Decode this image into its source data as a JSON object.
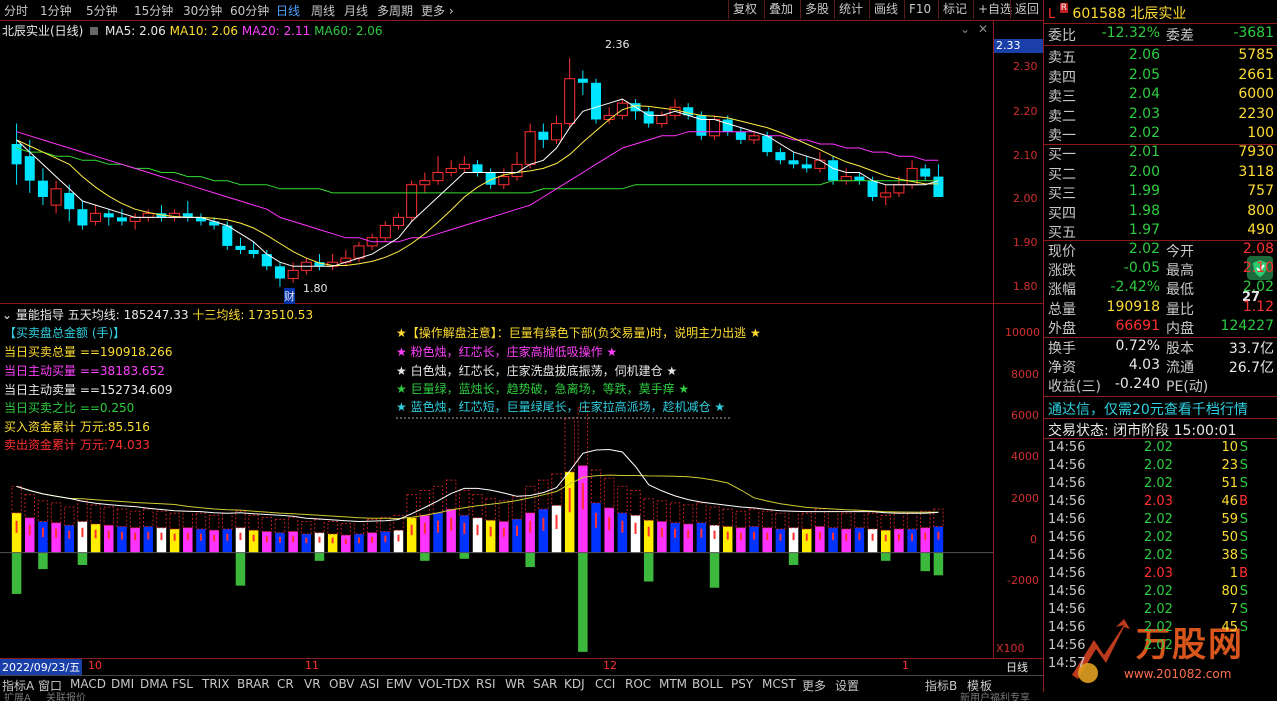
{
  "periods": [
    "分时",
    "1分钟",
    "5分钟",
    "15分钟",
    "30分钟",
    "60分钟",
    "日线",
    "周线",
    "月线",
    "多周期",
    "更多"
  ],
  "period_selected": "日线",
  "toolbar": [
    "复权",
    "叠加",
    "多股",
    "统计",
    "画线",
    "F10",
    "标记",
    "+自选",
    "返回"
  ],
  "title": "北辰实业(日线)",
  "ma": {
    "ma5": "MA5: 2.06",
    "ma10": "MA10: 2.06",
    "ma20": "MA20: 2.11",
    "ma60": "MA60: 2.06"
  },
  "price_axis": [
    "2.30",
    "2.20",
    "2.10",
    "2.00",
    "1.90",
    "1.80"
  ],
  "price_tag": "2.33",
  "high_label": "2.36",
  "low_label": "1.80",
  "cai_label": "财",
  "vol_header": {
    "name": "量能指导",
    "five": "五天均线: 185247.33",
    "thirteen": "十三均线: 173510.53"
  },
  "vol_axis": [
    "10000",
    "8000",
    "6000",
    "4000",
    "2000",
    "0",
    "-2000"
  ],
  "x100": "X100",
  "indicators": [
    {
      "text": "【买卖盘总金额 (手)】",
      "color": "#30d0e0"
    },
    {
      "text": "当日买卖总量 ==190918.266",
      "color": "#ffdd33"
    },
    {
      "text": "当日主动买量 ==38183.652",
      "color": "#ff40ff"
    },
    {
      "text": "当日主动卖量 ==152734.609",
      "color": "#e8e8e8"
    },
    {
      "text": "当日买卖之比 ==0.250",
      "color": "#2ecc40"
    },
    {
      "text": "买入资金累计 万元:85.516",
      "color": "#ffdd33"
    },
    {
      "text": "卖出资金累计 万元:74.033",
      "color": "#ff3030"
    }
  ],
  "notes": [
    {
      "text": "★【操作解盘注意】：巨量有绿色下部(负交易量)时，说明主力出逃 ★",
      "color": "#ffdd33"
    },
    {
      "text": "★ 粉色烛，红芯长，庄家高抛低吸操作 ★",
      "color": "#ff40ff"
    },
    {
      "text": "★ 白色烛，红芯长，庄家洗盘拔底振荡，伺机建仓 ★",
      "color": "#e8e8e8"
    },
    {
      "text": "★ 巨量绿，蓝烛长，趋势破，急离场，等跌，莫手痒 ★",
      "color": "#2ecc40"
    },
    {
      "text": "★ 蓝色烛，红芯短，巨量绿尾长，庄家拉高派场，趁机减仓 ★",
      "color": "#30d0e0"
    }
  ],
  "dates": {
    "start": "2022/09/23/五",
    "m10": "10",
    "m11": "11",
    "m12": "12",
    "m1": "1",
    "period": "日线"
  },
  "tabs": [
    "指标A",
    "窗口",
    "MACD",
    "DMI",
    "DMA",
    "FSL",
    "TRIX",
    "BRAR",
    "CR",
    "VR",
    "OBV",
    "ASI",
    "EMV",
    "VOL-TDX",
    "RSI",
    "WR",
    "SAR",
    "KDJ",
    "CCI",
    "ROC",
    "MTM",
    "BOLL",
    "PSY",
    "MCST",
    "更多",
    "设置"
  ],
  "tabs_right": [
    "指标B",
    "模",
    "板"
  ],
  "bottom": [
    "扩展A",
    "关联报价",
    "新用户福利专享"
  ],
  "stock": {
    "code": "601588",
    "name": "北辰实业",
    "tag_l": "L",
    "tag_r": "R"
  },
  "weibi": {
    "label": "委比",
    "value": "-12.32%",
    "label2": "委差",
    "value2": "-3681"
  },
  "sells": [
    {
      "label": "卖五",
      "price": "2.06",
      "vol": "5785"
    },
    {
      "label": "卖四",
      "price": "2.05",
      "vol": "2661"
    },
    {
      "label": "卖三",
      "price": "2.04",
      "vol": "6000"
    },
    {
      "label": "卖二",
      "price": "2.03",
      "vol": "2230"
    },
    {
      "label": "卖一",
      "price": "2.02",
      "vol": "100"
    }
  ],
  "buys": [
    {
      "label": "买一",
      "price": "2.01",
      "vol": "7930"
    },
    {
      "label": "买二",
      "price": "2.00",
      "vol": "3118"
    },
    {
      "label": "买三",
      "price": "1.99",
      "vol": "757"
    },
    {
      "label": "买四",
      "price": "1.98",
      "vol": "800"
    },
    {
      "label": "买五",
      "price": "1.97",
      "vol": "490"
    }
  ],
  "quote": [
    {
      "l1": "现价",
      "v1": "2.02",
      "c1": "g",
      "l2": "今开",
      "v2": "2.08",
      "c2": "r"
    },
    {
      "l1": "涨跌",
      "v1": "-0.05",
      "c1": "g",
      "l2": "最高",
      "v2": "2.10",
      "c2": "r"
    },
    {
      "l1": "涨幅",
      "v1": "-2.42%",
      "c1": "g",
      "l2": "最低",
      "v2": "2.02",
      "c2": "g"
    },
    {
      "l1": "总量",
      "v1": "190918",
      "c1": "y",
      "l2": "量比",
      "v2": "1.12",
      "c2": "r"
    },
    {
      "l1": "外盘",
      "v1": "66691",
      "c1": "r",
      "l2": "内盘",
      "v2": "124227",
      "c2": "g"
    }
  ],
  "quote2": [
    {
      "l1": "换手",
      "v1": "0.72%",
      "l2": "股本",
      "v2": "33.7亿"
    },
    {
      "l1": "净资",
      "v1": "4.03",
      "l2": "流通",
      "v2": "26.7亿"
    },
    {
      "l1": "收益(三)",
      "v1": "-0.240",
      "l2": "PE(动)",
      "v2": ""
    }
  ],
  "badge": "27",
  "ad": "通达信，仅需20元查看千档行情",
  "status": "交易状态: 闭市阶段 15:00:01",
  "ticks": [
    {
      "t": "14:56",
      "p": "2.02",
      "v": "10",
      "s": "S"
    },
    {
      "t": "14:56",
      "p": "2.02",
      "v": "23",
      "s": "S"
    },
    {
      "t": "14:56",
      "p": "2.02",
      "v": "51",
      "s": "S"
    },
    {
      "t": "14:56",
      "p": "2.03",
      "v": "46",
      "s": "B"
    },
    {
      "t": "14:56",
      "p": "2.02",
      "v": "59",
      "s": "S"
    },
    {
      "t": "14:56",
      "p": "2.02",
      "v": "50",
      "s": "S"
    },
    {
      "t": "14:56",
      "p": "2.02",
      "v": "38",
      "s": "S"
    },
    {
      "t": "14:56",
      "p": "2.03",
      "v": "1",
      "s": "B"
    },
    {
      "t": "14:56",
      "p": "2.02",
      "v": "80",
      "s": "S"
    },
    {
      "t": "14:56",
      "p": "2.02",
      "v": "7",
      "s": "S"
    },
    {
      "t": "14:56",
      "p": "2.02",
      "v": "45",
      "s": "S"
    },
    {
      "t": "14:56",
      "p": "2.02",
      "v": "",
      "s": ""
    },
    {
      "t": "14:57",
      "p": "",
      "v": "",
      "s": ""
    }
  ],
  "watermark": {
    "brand": "万股网",
    "url": "www.201082.com"
  },
  "colors": {
    "up": "#ff3030",
    "down": "#00e5ff",
    "ma5": "#ffffff",
    "ma10": "#ffee44",
    "ma20": "#ff33ff",
    "ma60": "#33dd33",
    "axis": "#8b1a1a"
  },
  "chart_data": {
    "type": "candlestick",
    "price_range": [
      1.76,
      2.4
    ],
    "candles": [
      [
        2.15,
        2.1,
        2.2,
        2.05
      ],
      [
        2.12,
        2.06,
        2.16,
        2.03
      ],
      [
        2.06,
        2.02,
        2.09,
        2.0
      ],
      [
        2.0,
        2.04,
        2.06,
        1.98
      ],
      [
        2.03,
        1.99,
        2.05,
        1.96
      ],
      [
        1.99,
        1.95,
        2.01,
        1.94
      ],
      [
        1.96,
        1.98,
        2.0,
        1.95
      ],
      [
        1.98,
        1.97,
        1.99,
        1.95
      ],
      [
        1.97,
        1.96,
        1.99,
        1.95
      ],
      [
        1.96,
        1.97,
        1.98,
        1.94
      ],
      [
        1.97,
        1.98,
        1.99,
        1.96
      ],
      [
        1.98,
        1.97,
        2.0,
        1.96
      ],
      [
        1.97,
        1.98,
        1.99,
        1.96
      ],
      [
        1.98,
        1.97,
        2.01,
        1.96
      ],
      [
        1.97,
        1.96,
        1.98,
        1.95
      ],
      [
        1.96,
        1.95,
        1.97,
        1.94
      ],
      [
        1.95,
        1.9,
        1.96,
        1.89
      ],
      [
        1.9,
        1.89,
        1.92,
        1.88
      ],
      [
        1.89,
        1.88,
        1.91,
        1.87
      ],
      [
        1.88,
        1.85,
        1.89,
        1.84
      ],
      [
        1.85,
        1.82,
        1.86,
        1.8
      ],
      [
        1.82,
        1.84,
        1.86,
        1.81
      ],
      [
        1.84,
        1.86,
        1.87,
        1.83
      ],
      [
        1.86,
        1.85,
        1.88,
        1.84
      ],
      [
        1.85,
        1.86,
        1.88,
        1.84
      ],
      [
        1.86,
        1.87,
        1.89,
        1.85
      ],
      [
        1.87,
        1.9,
        1.91,
        1.86
      ],
      [
        1.9,
        1.92,
        1.93,
        1.89
      ],
      [
        1.92,
        1.95,
        1.96,
        1.91
      ],
      [
        1.95,
        1.97,
        1.98,
        1.94
      ],
      [
        1.97,
        2.05,
        2.06,
        1.96
      ],
      [
        2.05,
        2.06,
        2.08,
        2.03
      ],
      [
        2.06,
        2.08,
        2.12,
        2.05
      ],
      [
        2.08,
        2.09,
        2.11,
        2.07
      ],
      [
        2.09,
        2.1,
        2.12,
        2.08
      ],
      [
        2.1,
        2.08,
        2.11,
        2.07
      ],
      [
        2.08,
        2.05,
        2.09,
        2.04
      ],
      [
        2.05,
        2.07,
        2.09,
        2.04
      ],
      [
        2.07,
        2.1,
        2.13,
        2.06
      ],
      [
        2.1,
        2.18,
        2.2,
        2.09
      ],
      [
        2.18,
        2.16,
        2.2,
        2.14
      ],
      [
        2.16,
        2.2,
        2.22,
        2.15
      ],
      [
        2.2,
        2.31,
        2.36,
        2.19
      ],
      [
        2.31,
        2.3,
        2.33,
        2.27
      ],
      [
        2.3,
        2.21,
        2.31,
        2.2
      ],
      [
        2.21,
        2.22,
        2.24,
        2.2
      ],
      [
        2.22,
        2.25,
        2.26,
        2.21
      ],
      [
        2.25,
        2.23,
        2.26,
        2.21
      ],
      [
        2.23,
        2.2,
        2.24,
        2.19
      ],
      [
        2.2,
        2.22,
        2.23,
        2.19
      ],
      [
        2.22,
        2.24,
        2.26,
        2.21
      ],
      [
        2.24,
        2.22,
        2.25,
        2.21
      ],
      [
        2.22,
        2.17,
        2.23,
        2.16
      ],
      [
        2.17,
        2.21,
        2.22,
        2.16
      ],
      [
        2.21,
        2.18,
        2.22,
        2.17
      ],
      [
        2.18,
        2.16,
        2.19,
        2.15
      ],
      [
        2.16,
        2.17,
        2.18,
        2.15
      ],
      [
        2.17,
        2.13,
        2.18,
        2.12
      ],
      [
        2.13,
        2.11,
        2.14,
        2.1
      ],
      [
        2.11,
        2.1,
        2.13,
        2.09
      ],
      [
        2.1,
        2.09,
        2.12,
        2.08
      ],
      [
        2.09,
        2.11,
        2.13,
        2.08
      ],
      [
        2.11,
        2.06,
        2.12,
        2.05
      ],
      [
        2.06,
        2.07,
        2.09,
        2.05
      ],
      [
        2.07,
        2.06,
        2.08,
        2.05
      ],
      [
        2.06,
        2.02,
        2.07,
        2.01
      ],
      [
        2.02,
        2.03,
        2.05,
        2.0
      ],
      [
        2.03,
        2.05,
        2.07,
        2.02
      ],
      [
        2.05,
        2.09,
        2.11,
        2.04
      ],
      [
        2.09,
        2.07,
        2.1,
        2.06
      ],
      [
        2.07,
        2.02,
        2.1,
        2.02
      ]
    ],
    "ma5": [
      2.16,
      2.13,
      2.1,
      2.07,
      2.04,
      2.01,
      2.0,
      1.99,
      1.98,
      1.97,
      1.97,
      1.97,
      1.97,
      1.97,
      1.97,
      1.96,
      1.95,
      1.93,
      1.91,
      1.88,
      1.86,
      1.85,
      1.85,
      1.85,
      1.85,
      1.86,
      1.87,
      1.88,
      1.9,
      1.92,
      1.96,
      1.99,
      2.02,
      2.05,
      2.08,
      2.08,
      2.08,
      2.08,
      2.08,
      2.1,
      2.11,
      2.14,
      2.19,
      2.23,
      2.24,
      2.25,
      2.26,
      2.24,
      2.22,
      2.22,
      2.23,
      2.22,
      2.21,
      2.21,
      2.2,
      2.19,
      2.18,
      2.17,
      2.15,
      2.13,
      2.12,
      2.11,
      2.09,
      2.08,
      2.08,
      2.06,
      2.05,
      2.05,
      2.05,
      2.05,
      2.06
    ],
    "ma20": [
      2.18,
      2.17,
      2.16,
      2.15,
      2.14,
      2.13,
      2.12,
      2.11,
      2.1,
      2.09,
      2.08,
      2.07,
      2.06,
      2.05,
      2.04,
      2.03,
      2.02,
      2.01,
      2.0,
      1.99,
      1.97,
      1.96,
      1.95,
      1.94,
      1.93,
      1.92,
      1.92,
      1.91,
      1.91,
      1.91,
      1.92,
      1.92,
      1.93,
      1.94,
      1.95,
      1.96,
      1.97,
      1.98,
      1.99,
      2.0,
      2.02,
      2.04,
      2.06,
      2.08,
      2.1,
      2.12,
      2.14,
      2.15,
      2.16,
      2.17,
      2.17,
      2.18,
      2.18,
      2.18,
      2.18,
      2.18,
      2.18,
      2.17,
      2.17,
      2.16,
      2.16,
      2.15,
      2.15,
      2.14,
      2.14,
      2.13,
      2.13,
      2.12,
      2.12,
      2.11,
      2.11
    ],
    "ma60": [
      2.14,
      2.13,
      2.13,
      2.12,
      2.12,
      2.11,
      2.11,
      2.1,
      2.1,
      2.09,
      2.09,
      2.08,
      2.08,
      2.07,
      2.07,
      2.06,
      2.06,
      2.05,
      2.05,
      2.05,
      2.04,
      2.04,
      2.04,
      2.04,
      2.03,
      2.03,
      2.03,
      2.03,
      2.03,
      2.03,
      2.03,
      2.03,
      2.03,
      2.03,
      2.03,
      2.03,
      2.03,
      2.03,
      2.03,
      2.03,
      2.04,
      2.04,
      2.04,
      2.04,
      2.04,
      2.04,
      2.04,
      2.05,
      2.05,
      2.05,
      2.05,
      2.05,
      2.05,
      2.05,
      2.05,
      2.05,
      2.05,
      2.05,
      2.05,
      2.05,
      2.05,
      2.05,
      2.06,
      2.06,
      2.06,
      2.06,
      2.06,
      2.06,
      2.06,
      2.06,
      2.06
    ],
    "vol_range": [
      -5000,
      11000
    ],
    "vol": [
      3200,
      2800,
      2500,
      2400,
      2200,
      2500,
      2300,
      2200,
      2100,
      2000,
      2100,
      2000,
      1900,
      2000,
      1900,
      1800,
      1900,
      2000,
      1800,
      1700,
      1600,
      1700,
      1500,
      1600,
      1500,
      1400,
      1500,
      1600,
      1700,
      1800,
      2800,
      3000,
      3200,
      3500,
      3000,
      2800,
      2600,
      2500,
      2700,
      3200,
      3500,
      3800,
      6500,
      7000,
      4000,
      3600,
      3200,
      3000,
      2600,
      2500,
      2400,
      2300,
      2400,
      2200,
      2100,
      2000,
      2100,
      2000,
      1900,
      2000,
      1900,
      2100,
      2000,
      1900,
      2000,
      1900,
      1800,
      1900,
      1900,
      2000,
      2100
    ],
    "vol_neg": [
      -2000,
      0,
      -800,
      0,
      0,
      -600,
      0,
      0,
      0,
      0,
      0,
      0,
      0,
      0,
      0,
      0,
      0,
      -1600,
      0,
      0,
      0,
      0,
      0,
      -400,
      0,
      0,
      0,
      0,
      0,
      0,
      0,
      -400,
      0,
      0,
      -300,
      0,
      0,
      0,
      0,
      -700,
      0,
      0,
      0,
      -4800,
      0,
      0,
      0,
      0,
      -1400,
      0,
      0,
      0,
      0,
      -1700,
      0,
      0,
      0,
      0,
      0,
      -600,
      0,
      0,
      0,
      0,
      0,
      0,
      -400,
      0,
      0,
      -900,
      -1100
    ]
  }
}
